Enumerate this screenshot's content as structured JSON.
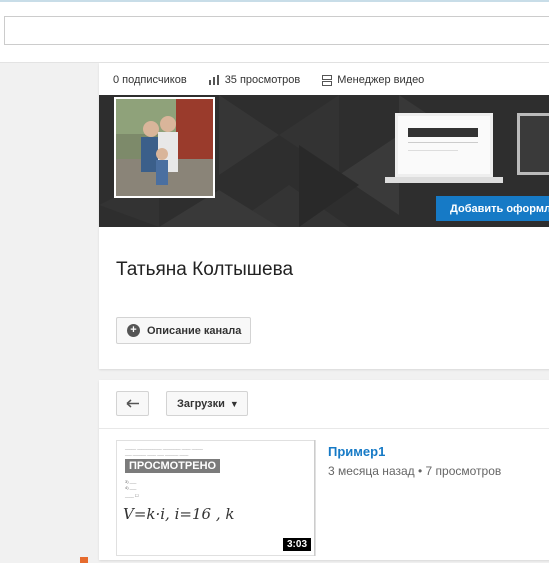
{
  "stats": {
    "subscribers": "0 подписчиков",
    "views": "35 просмотров",
    "video_manager": "Менеджер видео"
  },
  "banner": {
    "add_art_label": "Добавить оформл"
  },
  "channel": {
    "name": "Татьяна Колтышева",
    "about_label": "Описание канала"
  },
  "uploads": {
    "menu_label": "Загрузки"
  },
  "video": {
    "title": "Пример1",
    "meta": "3 месяца назад • 7 просмотров",
    "watched_label": "ПРОСМОТРЕНО",
    "duration": "3:03"
  },
  "colors": {
    "accent": "#167ac6",
    "banner_bg": "#2e2e2e"
  }
}
